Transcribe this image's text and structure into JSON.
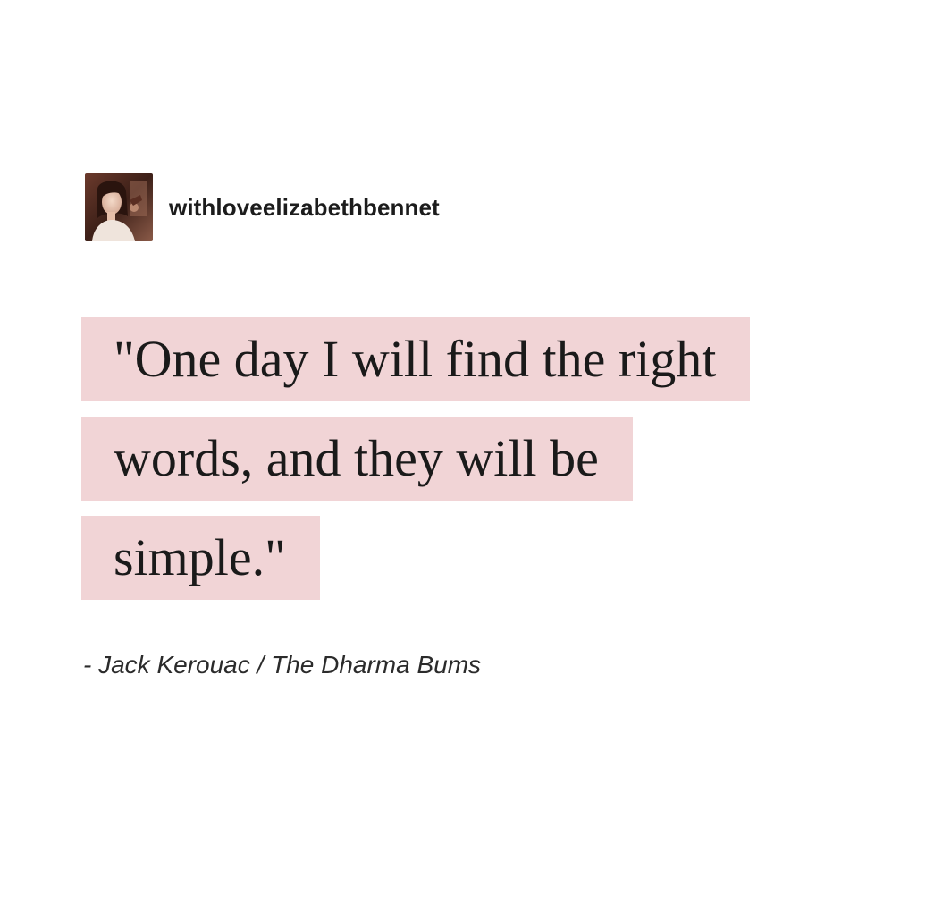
{
  "post": {
    "author": {
      "username": "withloveelizabethbennet",
      "avatar_icon": "avatar-portrait"
    },
    "quote": {
      "lines": [
        "\"One day I will find the right",
        "words, and they will be",
        "simple.\""
      ],
      "highlight_color": "#f1d4d6"
    },
    "attribution": "- Jack Kerouac / The Dharma Bums"
  }
}
